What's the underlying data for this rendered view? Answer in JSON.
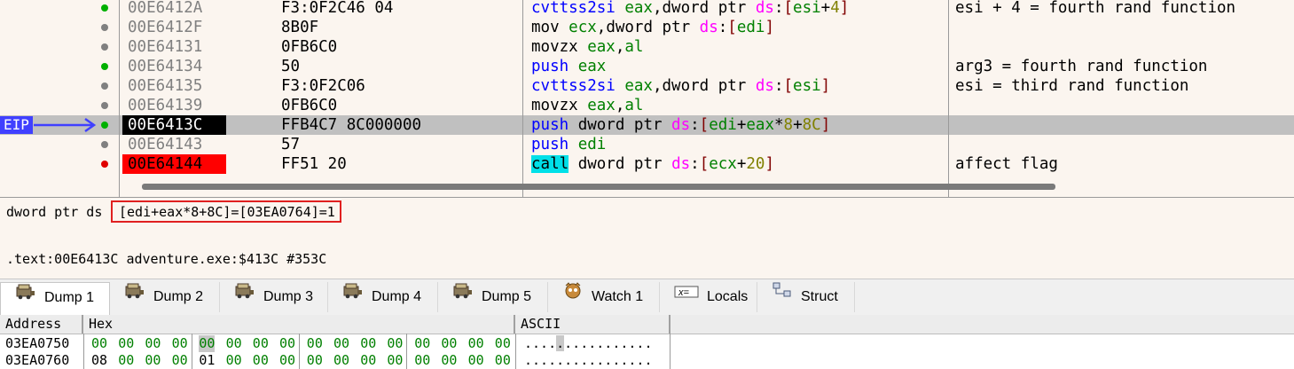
{
  "disassembly": {
    "eip_label": "EIP",
    "rows": [
      {
        "addr": "00E6412A",
        "bytes": "F3:0F2C46 04",
        "dot": "green",
        "comment": "esi + 4 = fourth rand function",
        "instr": [
          [
            "mn",
            "cvttss2si "
          ],
          [
            "rg",
            "eax"
          ],
          [
            "pt",
            ","
          ],
          [
            "pt",
            "dword ptr "
          ],
          [
            "sg",
            "ds"
          ],
          [
            "pt",
            ":"
          ],
          [
            "sq",
            "["
          ],
          [
            "rg",
            "esi"
          ],
          [
            "pt",
            "+"
          ],
          [
            "nm",
            "4"
          ],
          [
            "sq",
            "]"
          ]
        ]
      },
      {
        "addr": "00E6412F",
        "bytes": "8B0F",
        "dot": "gray",
        "comment": "",
        "instr": [
          [
            "pt",
            "mov "
          ],
          [
            "rg",
            "ecx"
          ],
          [
            "pt",
            ","
          ],
          [
            "pt",
            "dword ptr "
          ],
          [
            "sg",
            "ds"
          ],
          [
            "pt",
            ":"
          ],
          [
            "sq",
            "["
          ],
          [
            "rg",
            "edi"
          ],
          [
            "sq",
            "]"
          ]
        ]
      },
      {
        "addr": "00E64131",
        "bytes": "0FB6C0",
        "dot": "gray",
        "comment": "",
        "instr": [
          [
            "pt",
            "movzx "
          ],
          [
            "rg",
            "eax"
          ],
          [
            "pt",
            ","
          ],
          [
            "rg",
            "al"
          ]
        ]
      },
      {
        "addr": "00E64134",
        "bytes": "50",
        "dot": "green",
        "comment": "arg3 = fourth rand function",
        "instr": [
          [
            "mn",
            "push "
          ],
          [
            "rg",
            "eax"
          ]
        ]
      },
      {
        "addr": "00E64135",
        "bytes": "F3:0F2C06",
        "dot": "gray",
        "comment": "esi = third rand function",
        "instr": [
          [
            "mn",
            "cvttss2si "
          ],
          [
            "rg",
            "eax"
          ],
          [
            "pt",
            ","
          ],
          [
            "pt",
            "dword ptr "
          ],
          [
            "sg",
            "ds"
          ],
          [
            "pt",
            ":"
          ],
          [
            "sq",
            "["
          ],
          [
            "rg",
            "esi"
          ],
          [
            "sq",
            "]"
          ]
        ]
      },
      {
        "addr": "00E64139",
        "bytes": "0FB6C0",
        "dot": "gray",
        "comment": "",
        "instr": [
          [
            "pt",
            "movzx "
          ],
          [
            "rg",
            "eax"
          ],
          [
            "pt",
            ","
          ],
          [
            "rg",
            "al"
          ]
        ]
      },
      {
        "addr": "00E6413C",
        "bytes": "FFB4C7 8C000000",
        "dot": "green",
        "comment": "",
        "state": "eip",
        "instr": [
          [
            "mn",
            "push "
          ],
          [
            "pt",
            "dword ptr "
          ],
          [
            "sg",
            "ds"
          ],
          [
            "pt",
            ":"
          ],
          [
            "sq",
            "["
          ],
          [
            "rg",
            "edi"
          ],
          [
            "pt",
            "+"
          ],
          [
            "rg",
            "eax"
          ],
          [
            "pt",
            "*"
          ],
          [
            "nm",
            "8"
          ],
          [
            "pt",
            "+"
          ],
          [
            "nm",
            "8C"
          ],
          [
            "sq",
            "]"
          ]
        ]
      },
      {
        "addr": "00E64143",
        "bytes": "57",
        "dot": "gray",
        "comment": "",
        "instr": [
          [
            "mn",
            "push "
          ],
          [
            "rg",
            "edi"
          ]
        ]
      },
      {
        "addr": "00E64144",
        "bytes": "FF51 20",
        "dot": "red",
        "comment": "affect flag",
        "state": "bp",
        "instr": [
          [
            "mnc",
            "call"
          ],
          [
            "pt",
            " dword ptr "
          ],
          [
            "sg",
            "ds"
          ],
          [
            "pt",
            ":"
          ],
          [
            "sq",
            "["
          ],
          [
            "rg",
            "ecx"
          ],
          [
            "pt",
            "+"
          ],
          [
            "nm",
            "20"
          ],
          [
            "sq",
            "]"
          ]
        ]
      }
    ]
  },
  "info": {
    "prefix": "dword ptr ds",
    "boxed": "[edi+eax*8+8C]=[03EA0764]=1",
    "location": ".text:00E6413C adventure.exe:$413C #353C"
  },
  "tabs": [
    {
      "label": "Dump 1",
      "icon": "dump-icon",
      "active": true
    },
    {
      "label": "Dump 2",
      "icon": "dump-icon"
    },
    {
      "label": "Dump 3",
      "icon": "dump-icon"
    },
    {
      "label": "Dump 4",
      "icon": "dump-icon"
    },
    {
      "label": "Dump 5",
      "icon": "dump-icon"
    },
    {
      "label": "Watch 1",
      "icon": "watch-icon"
    },
    {
      "label": "Locals",
      "icon": "locals-icon"
    },
    {
      "label": "Struct",
      "icon": "struct-icon"
    }
  ],
  "dump": {
    "headers": {
      "address": "Address",
      "hex": "Hex",
      "ascii": "ASCII"
    },
    "rows": [
      {
        "addr": "03EA0750",
        "hex": [
          "00",
          "00",
          "00",
          "00",
          "00",
          "00",
          "00",
          "00",
          "00",
          "00",
          "00",
          "00",
          "00",
          "00",
          "00",
          "00"
        ],
        "ascii": "................",
        "selected_byte": 4
      },
      {
        "addr": "03EA0760",
        "hex": [
          "08",
          "00",
          "00",
          "00",
          "01",
          "00",
          "00",
          "00",
          "00",
          "00",
          "00",
          "00",
          "00",
          "00",
          "00",
          "00"
        ],
        "ascii": "................"
      }
    ]
  },
  "colors": {
    "background": "#fbf5ef",
    "eip_highlight": "#c0c0c0",
    "breakpoint": "#ff0000",
    "eip_label": "#4040ff",
    "call_highlight": "#00e0e8",
    "error_box": "#e02020"
  }
}
